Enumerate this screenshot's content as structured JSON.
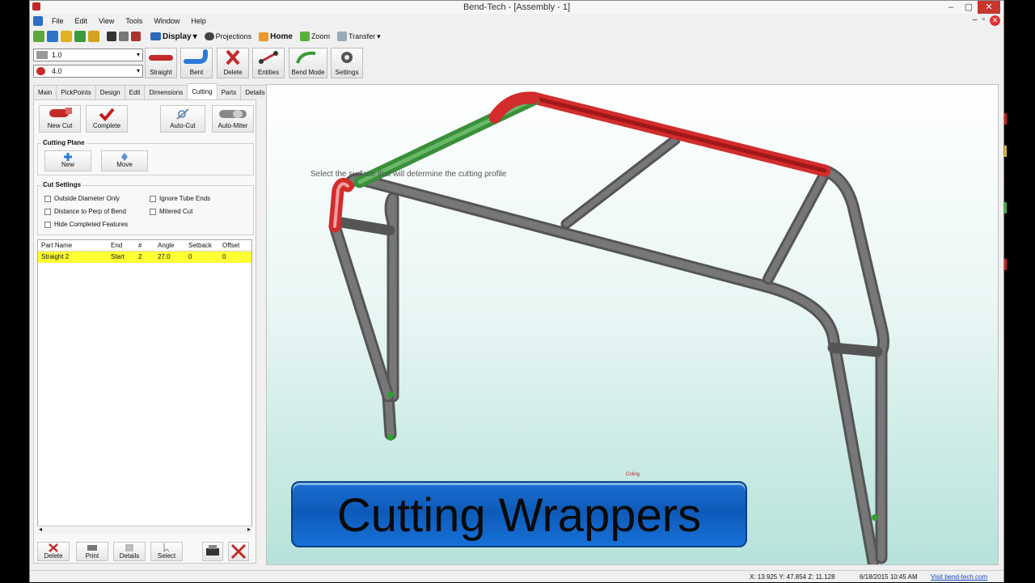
{
  "window": {
    "title": "Bend-Tech - [Assembly - 1]",
    "minimize": "–",
    "maximize": "▢",
    "close": "✕"
  },
  "menu": {
    "items": [
      "File",
      "Edit",
      "View",
      "Tools",
      "Window",
      "Help"
    ],
    "mdi": [
      "–",
      "▫",
      "✕"
    ]
  },
  "quick_toolbar": {
    "display": "Display",
    "projections": "Projections",
    "home": "Home",
    "zoom": "Zoom",
    "transfer": "Transfer"
  },
  "selects": {
    "diameter": "1.0",
    "radius": "4.0"
  },
  "ribbon": [
    "Straight",
    "Bent",
    "Delete",
    "Entities",
    "Bend Mode",
    "Settings"
  ],
  "tabs": [
    "Main",
    "PickPoints",
    "Design",
    "Edit",
    "Dimensions",
    "Cutting",
    "Parts",
    "Details"
  ],
  "active_tab": "Cutting",
  "cutting": {
    "buttons": [
      "New Cut",
      "Complete",
      "Auto-Cut",
      "Auto-Miter"
    ],
    "plane": {
      "title": "Cutting Plane",
      "new": "New",
      "move": "Move"
    },
    "settings": {
      "title": "Cut Settings",
      "options": [
        "Outside Diameter Only",
        "Distance to Perp of Bend",
        "Hide Completed Features",
        "Ignore Tube Ends",
        "Mitered Cut"
      ]
    },
    "table": {
      "columns": [
        "Part Name",
        "End",
        "#",
        "Angle",
        "Setback",
        "Offset"
      ],
      "rows": [
        [
          "Straight 2",
          "Start",
          "2",
          "27.0",
          "0",
          "0"
        ]
      ]
    },
    "bottom_buttons": [
      "Delete",
      "Print",
      "Details",
      "Select"
    ]
  },
  "viewport": {
    "hint": "Select the surface that will determine the cutting profile",
    "small_label": "Coling",
    "banner": "Cutting Wrappers",
    "colors": {
      "red_tube": "#d22c2c",
      "green_tube": "#3a8f3a",
      "gray_tube": "#6e6e6e"
    }
  },
  "status": {
    "coords": "X: 13.925  Y: 47.854  Z: 11.128",
    "datetime": "6/18/2015  10:45 AM",
    "link": "Visit bend-tech.com"
  }
}
